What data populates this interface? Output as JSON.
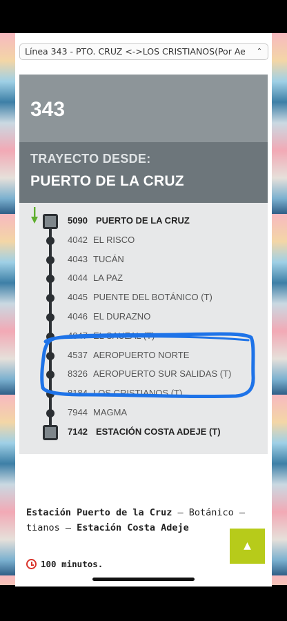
{
  "route_select": {
    "selected": "Línea 343 - PTO. CRUZ <->LOS CRISTIANOS(Por Ae"
  },
  "line": {
    "number": "343"
  },
  "trayecto": {
    "label": "TRAYECTO DESDE:",
    "origin": "PUERTO DE LA CRUZ"
  },
  "stops": [
    {
      "code": "5090",
      "name": "PUERTO DE LA CRUZ",
      "terminal": true
    },
    {
      "code": "4042",
      "name": "EL RISCO"
    },
    {
      "code": "4043",
      "name": "TUCÁN"
    },
    {
      "code": "4044",
      "name": "LA PAZ"
    },
    {
      "code": "4045",
      "name": "PUENTE DEL BOTÁNICO (T)"
    },
    {
      "code": "4046",
      "name": "EL DURAZNO"
    },
    {
      "code": "4047",
      "name": "EL SAUZAL (T)"
    },
    {
      "code": "4537",
      "name": "AEROPUERTO NORTE"
    },
    {
      "code": "8326",
      "name": "AEROPUERTO SUR SALIDAS (T)"
    },
    {
      "code": "8184",
      "name": "LOS CRISTIANOS (T)"
    },
    {
      "code": "7944",
      "name": "MAGMA"
    },
    {
      "code": "7142",
      "name": "ESTACIÓN COSTA ADEJE (T)",
      "terminal": true
    }
  ],
  "description": {
    "line1_bold": "Estación Puerto de la Cruz",
    "line1_sep": " – ",
    "line1_rest": "Botánico – ",
    "line2_start": "tianos – ",
    "line2_bold": "Estación Costa Adeje"
  },
  "duration": {
    "text": "100 minutos."
  },
  "colors": {
    "accent_green": "#b7cb1a",
    "highlight_blue": "#1e73e8",
    "rail": "#2b2f33"
  },
  "icons": {
    "scroll_top": "chevron-up-icon",
    "duration": "alarm-clock-icon",
    "direction": "arrow-down-icon"
  }
}
